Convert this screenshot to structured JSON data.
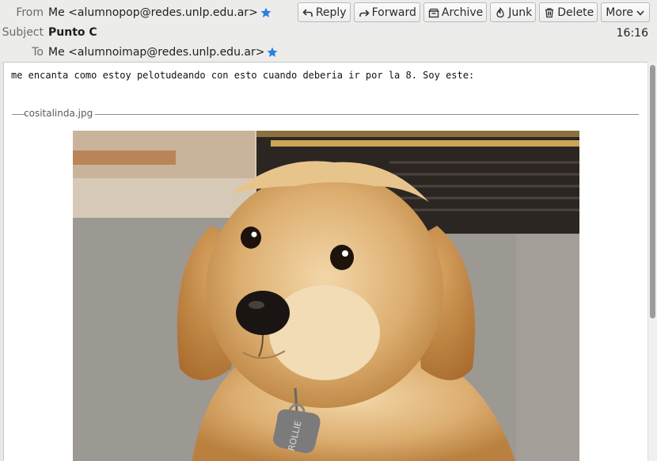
{
  "header": {
    "from_label": "From",
    "from_value": "Me <alumnopop@redes.unlp.edu.ar>",
    "subject_label": "Subject",
    "subject_value": "Punto C",
    "to_label": "To",
    "to_value": "Me <alumnoimap@redes.unlp.edu.ar>",
    "time": "16:16"
  },
  "toolbar": {
    "reply": "Reply",
    "forward": "Forward",
    "archive": "Archive",
    "junk": "Junk",
    "delete": "Delete",
    "more": "More"
  },
  "message": {
    "body": "me encanta como estoy pelotudeando con esto cuando deberia ir por la 8. Soy este:",
    "attachment_name": "cositalinda.jpg",
    "tag_text": "ROLLIE"
  },
  "colors": {
    "star": "#2a7fe0",
    "accent": "#2a7fe0"
  },
  "icons": [
    "star-icon",
    "reply-icon",
    "forward-icon",
    "archive-icon",
    "junk-icon",
    "delete-icon",
    "chevron-down-icon"
  ]
}
